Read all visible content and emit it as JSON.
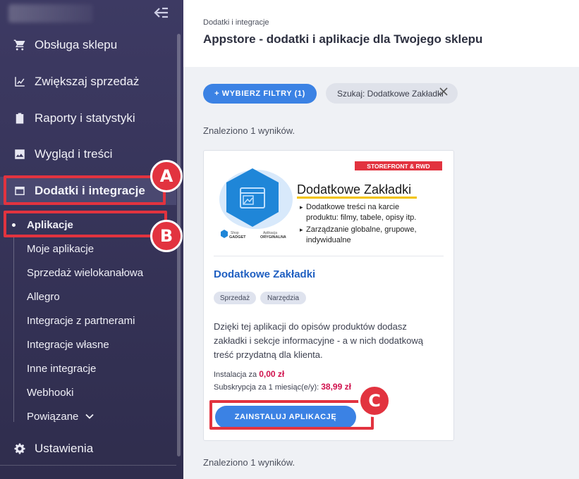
{
  "sidebar": {
    "items": [
      {
        "label": "Obsługa sklepu",
        "icon": "cart-icon"
      },
      {
        "label": "Zwiększaj sprzedaż",
        "icon": "chart-icon"
      },
      {
        "label": "Raporty i statystyki",
        "icon": "clipboard-icon"
      },
      {
        "label": "Wygląd i treści",
        "icon": "image-icon"
      },
      {
        "label": "Dodatki i integracje",
        "icon": "window-icon"
      }
    ],
    "subitems": [
      "Aplikacje",
      "Moje aplikacje",
      "Sprzedaż wielokanałowa",
      "Allegro",
      "Integracje z partnerami",
      "Integracje własne",
      "Inne integracje",
      "Webhooki",
      "Powiązane"
    ],
    "settings_label": "Ustawienia"
  },
  "header": {
    "breadcrumb": "Dodatki i integracje",
    "title": "Appstore - dodatki i aplikacje dla Twojego sklepu"
  },
  "filters": {
    "button_label": "+ WYBIERZ FILTRY (1)",
    "search_chip": "Szukaj: Dodatkowe Zakładki"
  },
  "results_text": "Znaleziono 1 wyników.",
  "card": {
    "banner": {
      "badge": "STOREFRONT & RWD",
      "title": "Dodatkowe Zakładki",
      "bullets": [
        [
          "Dodatkowe treści na karcie",
          "produktu: filmy, tabele, opisy itp."
        ],
        [
          "Zarządzanie globalne, grupowe,",
          "indywidualne"
        ]
      ],
      "logo_shop_line1": "Shop",
      "logo_shop_line2": "GADGET",
      "logo_app_line1": "Aplikacja",
      "logo_app_line2": "ORYGINALNA"
    },
    "title": "Dodatkowe Zakładki",
    "tags": [
      "Sprzedaż",
      "Narzędzia"
    ],
    "description": "Dzięki tej aplikacji do opisów produktów dodasz zakładki i sekcje informacyjne - a w nich dodatkową treść przydatną dla klienta.",
    "install_label": "Instalacja za",
    "install_price": "0,00 zł",
    "subscription_label": "Subskrypcja za 1 miesiąc(e/y):",
    "subscription_price": "38,99 zł",
    "install_button": "ZAINSTALUJ APLIKACJĘ"
  },
  "annotations": [
    "A",
    "B",
    "C"
  ],
  "colors": {
    "accent": "#3b82e4",
    "highlight": "#e2333f",
    "price": "#d0104c",
    "sidebar": "#3d3a63"
  }
}
